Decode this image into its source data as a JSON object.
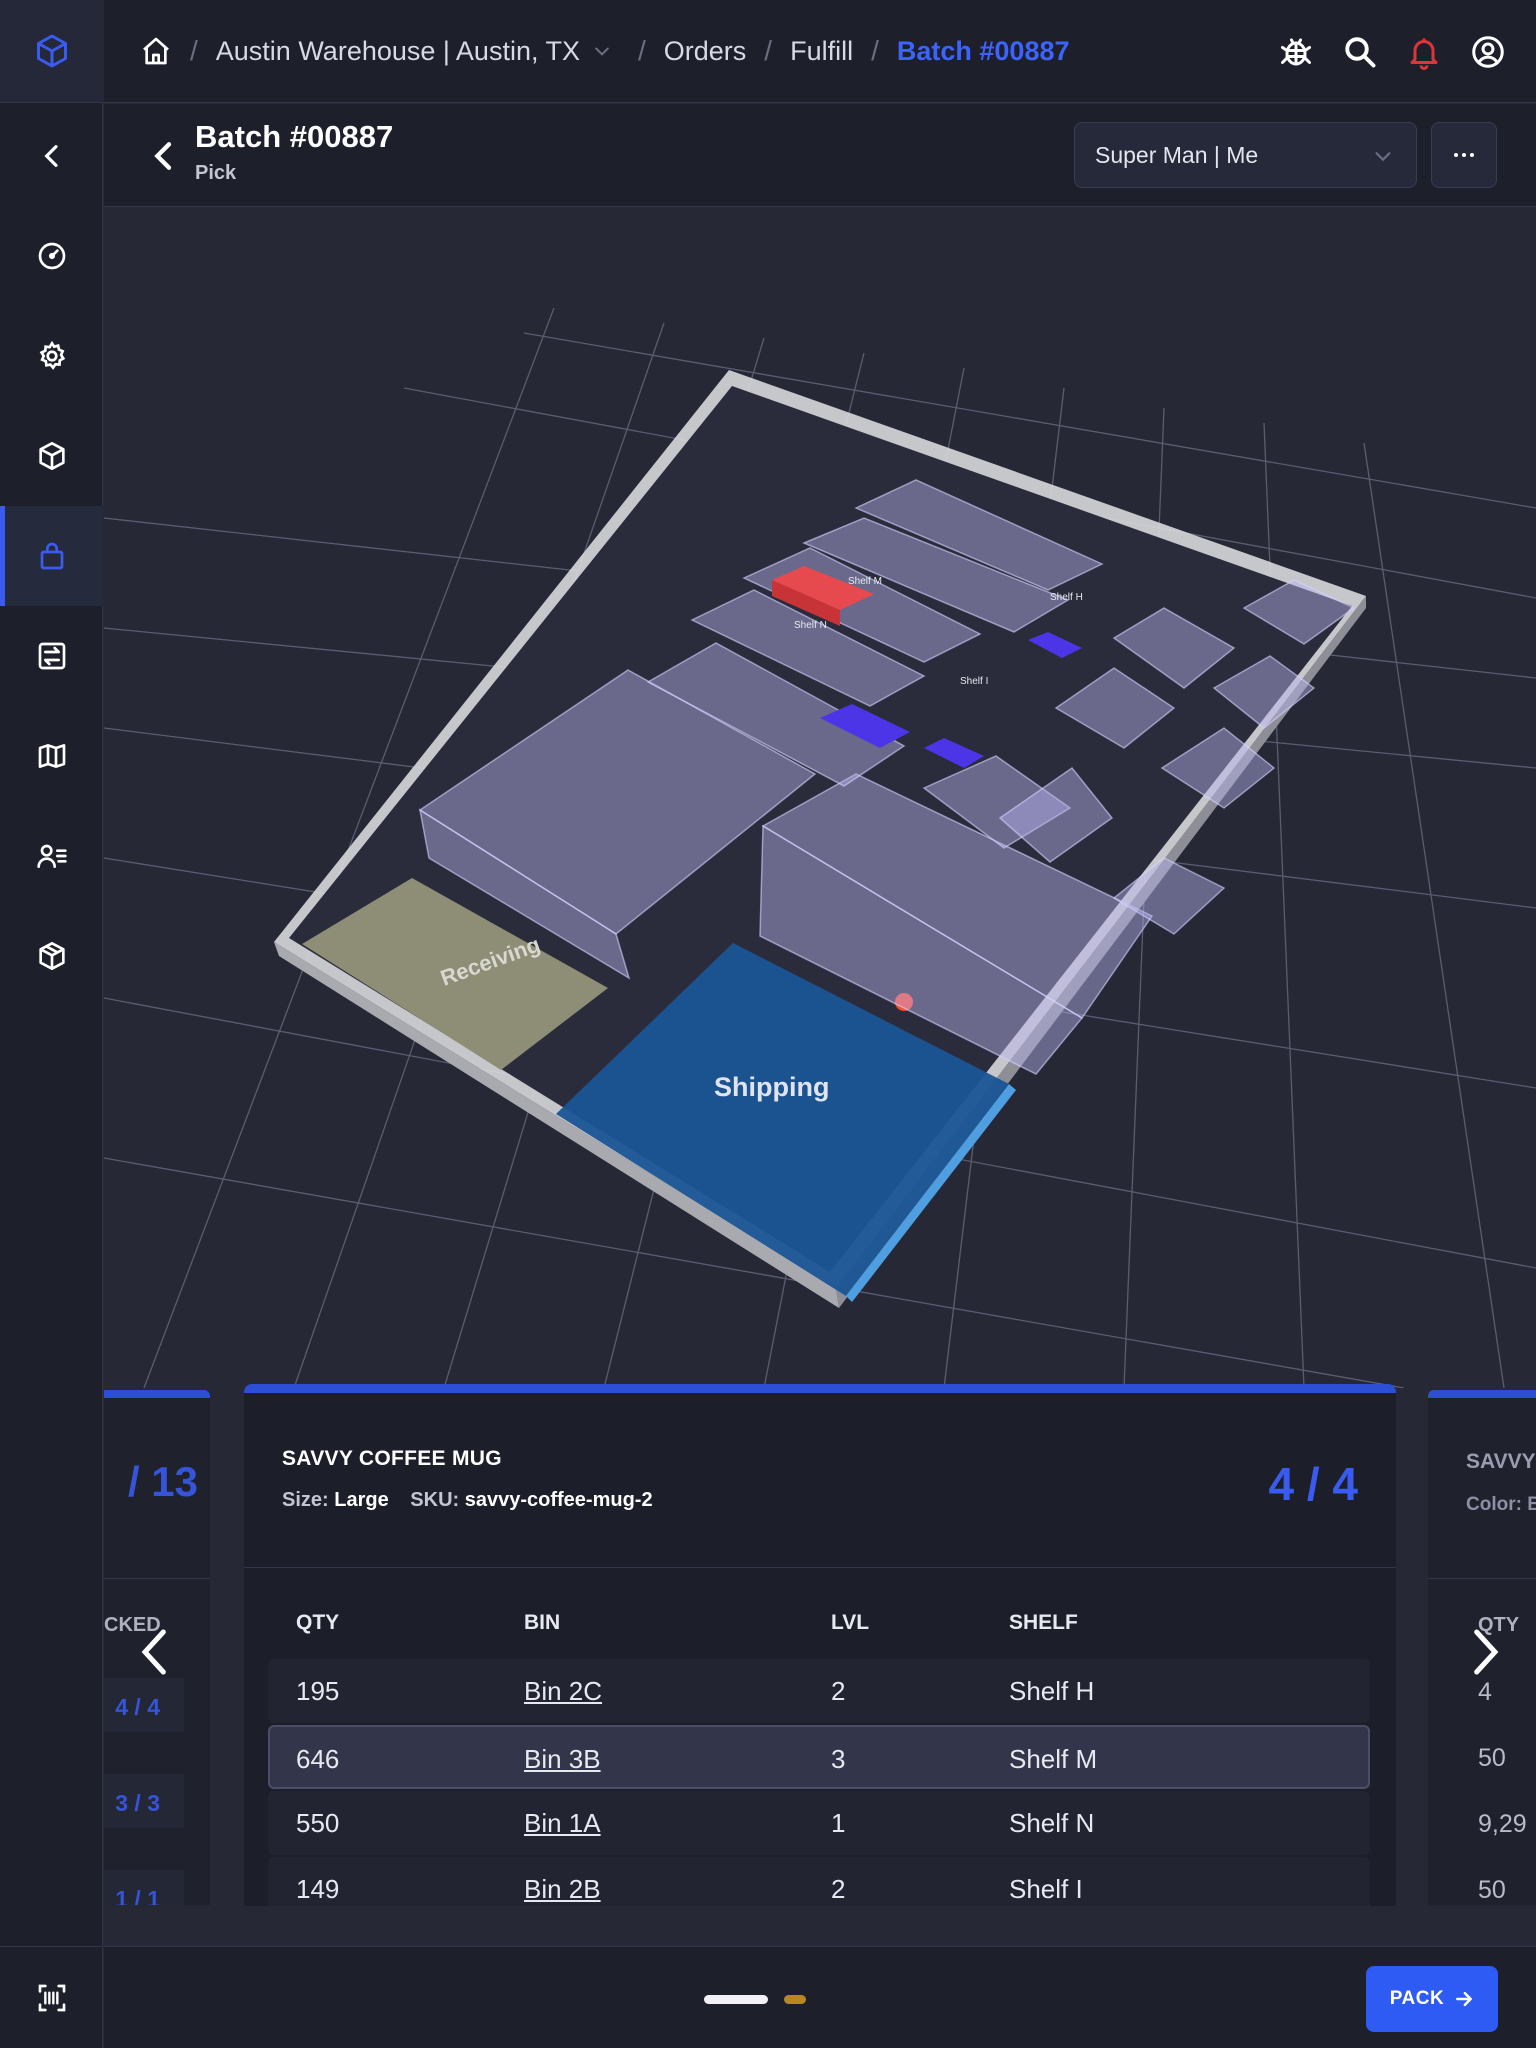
{
  "breadcrumb": {
    "location": "Austin Warehouse | Austin, TX",
    "orders": "Orders",
    "fulfill": "Fulfill",
    "batch": "Batch #00887"
  },
  "header": {
    "title": "Batch #00887",
    "subtitle": "Pick",
    "user_select": "Super Man | Me",
    "more_label": "···"
  },
  "map": {
    "zone_receiving": "Receiving",
    "zone_shipping": "Shipping",
    "shelf_labels": [
      "Shelf M",
      "Shelf N",
      "Shelf H",
      "Shelf I"
    ]
  },
  "left_card": {
    "count": "/ 13",
    "col_packed": "CKED",
    "rows": [
      "4 / 4",
      "3 / 3",
      "1 / 1"
    ]
  },
  "item": {
    "name": "SAVVY COFFEE MUG",
    "size_label": "Size:",
    "size_value": "Large",
    "sku_label": "SKU:",
    "sku_value": "savvy-coffee-mug-2",
    "progress": "4 / 4",
    "columns": {
      "qty": "QTY",
      "bin": "BIN",
      "lvl": "LVL",
      "shelf": "SHELF"
    },
    "rows": [
      {
        "qty": "195",
        "bin": "Bin 2C",
        "lvl": "2",
        "shelf": "Shelf H"
      },
      {
        "qty": "646",
        "bin": "Bin 3B",
        "lvl": "3",
        "shelf": "Shelf M"
      },
      {
        "qty": "550",
        "bin": "Bin 1A",
        "lvl": "1",
        "shelf": "Shelf N"
      },
      {
        "qty": "149",
        "bin": "Bin 2B",
        "lvl": "2",
        "shelf": "Shelf I"
      }
    ]
  },
  "right_card": {
    "name": "SAVVY",
    "meta": "Color: B",
    "col_qty": "QTY",
    "rows": [
      "4",
      "50",
      "9,29",
      "50"
    ]
  },
  "footer": {
    "pack_label": "PACK"
  },
  "colors": {
    "accent": "#3a5bf0",
    "alert": "#e0343d",
    "shipping": "#1d5fa5",
    "receiving": "#8e8d76",
    "highlight_bin": "#e64a4f"
  }
}
